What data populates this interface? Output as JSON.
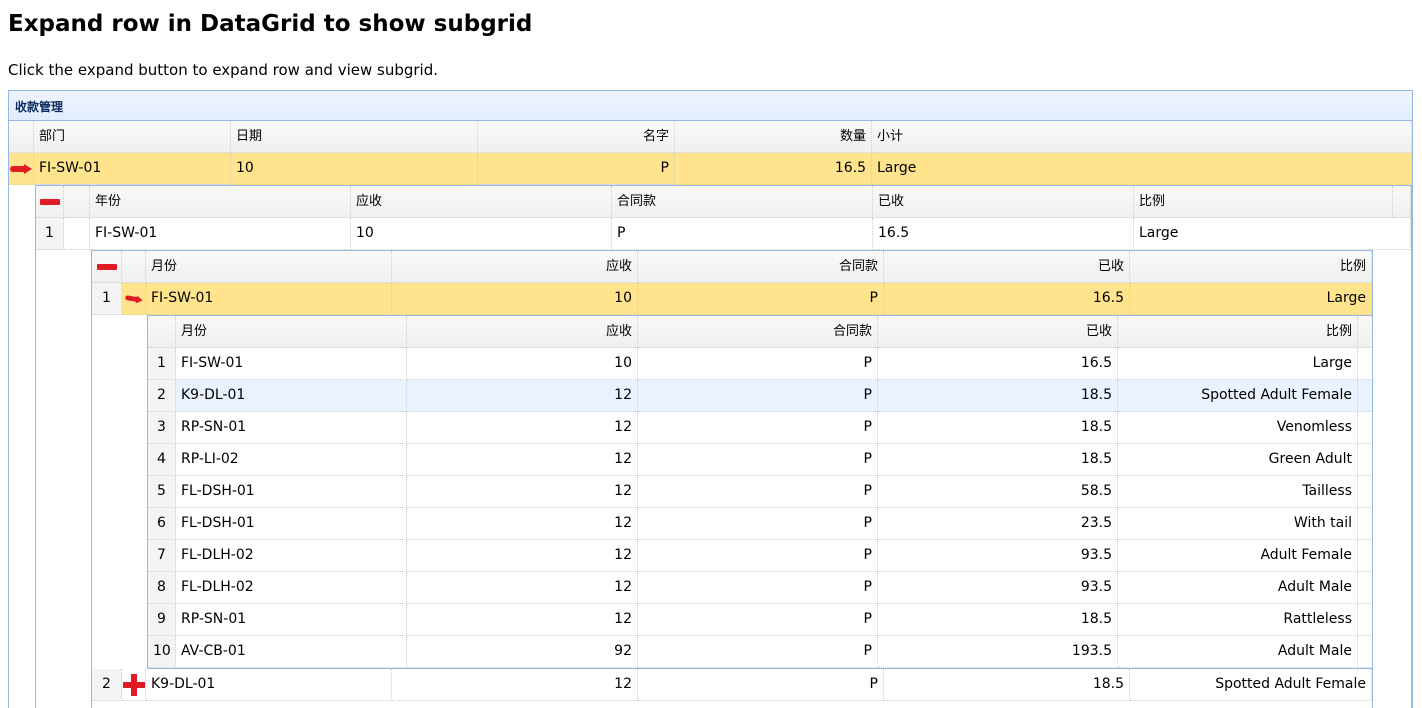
{
  "page": {
    "title": "Expand row in DataGrid to show subgrid",
    "description": "Click the expand button to expand row and view subgrid."
  },
  "panel": {
    "title": "收款管理"
  },
  "main_grid": {
    "columns": [
      "部门",
      "日期",
      "名字",
      "数量",
      "小计"
    ],
    "row": {
      "dept": "FI-SW-01",
      "date": "10",
      "name": "P",
      "qty": "16.5",
      "subtotal": "Large"
    }
  },
  "year_grid": {
    "columns": [
      "年份",
      "应收",
      "合同款",
      "已收",
      "比例"
    ],
    "row": {
      "num": "1",
      "year": "FI-SW-01",
      "receivable": "10",
      "contract": "P",
      "received": "16.5",
      "ratio": "Large"
    }
  },
  "month_grid": {
    "columns": [
      "月份",
      "应收",
      "合同款",
      "已收",
      "比例"
    ],
    "rows": [
      {
        "num": "1",
        "month": "FI-SW-01",
        "receivable": "10",
        "contract": "P",
        "received": "16.5",
        "ratio": "Large"
      },
      {
        "num": "2",
        "month": "K9-DL-01",
        "receivable": "12",
        "contract": "P",
        "received": "18.5",
        "ratio": "Spotted Adult Female"
      }
    ]
  },
  "detail_grid": {
    "columns": [
      "月份",
      "应收",
      "合同款",
      "已收",
      "比例"
    ],
    "rows": [
      {
        "num": "1",
        "month": "FI-SW-01",
        "receivable": "10",
        "contract": "P",
        "received": "16.5",
        "ratio": "Large"
      },
      {
        "num": "2",
        "month": "K9-DL-01",
        "receivable": "12",
        "contract": "P",
        "received": "18.5",
        "ratio": "Spotted Adult Female"
      },
      {
        "num": "3",
        "month": "RP-SN-01",
        "receivable": "12",
        "contract": "P",
        "received": "18.5",
        "ratio": "Venomless"
      },
      {
        "num": "4",
        "month": "RP-LI-02",
        "receivable": "12",
        "contract": "P",
        "received": "18.5",
        "ratio": "Green Adult"
      },
      {
        "num": "5",
        "month": "FL-DSH-01",
        "receivable": "12",
        "contract": "P",
        "received": "58.5",
        "ratio": "Tailless"
      },
      {
        "num": "6",
        "month": "FL-DSH-01",
        "receivable": "12",
        "contract": "P",
        "received": "23.5",
        "ratio": "With tail"
      },
      {
        "num": "7",
        "month": "FL-DLH-02",
        "receivable": "12",
        "contract": "P",
        "received": "93.5",
        "ratio": "Adult Female"
      },
      {
        "num": "8",
        "month": "FL-DLH-02",
        "receivable": "12",
        "contract": "P",
        "received": "93.5",
        "ratio": "Adult Male"
      },
      {
        "num": "9",
        "month": "RP-SN-01",
        "receivable": "12",
        "contract": "P",
        "received": "18.5",
        "ratio": "Rattleless"
      },
      {
        "num": "10",
        "month": "AV-CB-01",
        "receivable": "92",
        "contract": "P",
        "received": "193.5",
        "ratio": "Adult Male"
      }
    ]
  },
  "icons": {
    "expand_arrow": "red-arrow-icon",
    "collapse": "red-minus-icon",
    "expand": "red-plus-icon"
  },
  "colors": {
    "selected_row": "#ffe48d",
    "hover_row": "#eaf2ff",
    "panel_border": "#95b8e7",
    "icon_red": "#e01b24"
  }
}
